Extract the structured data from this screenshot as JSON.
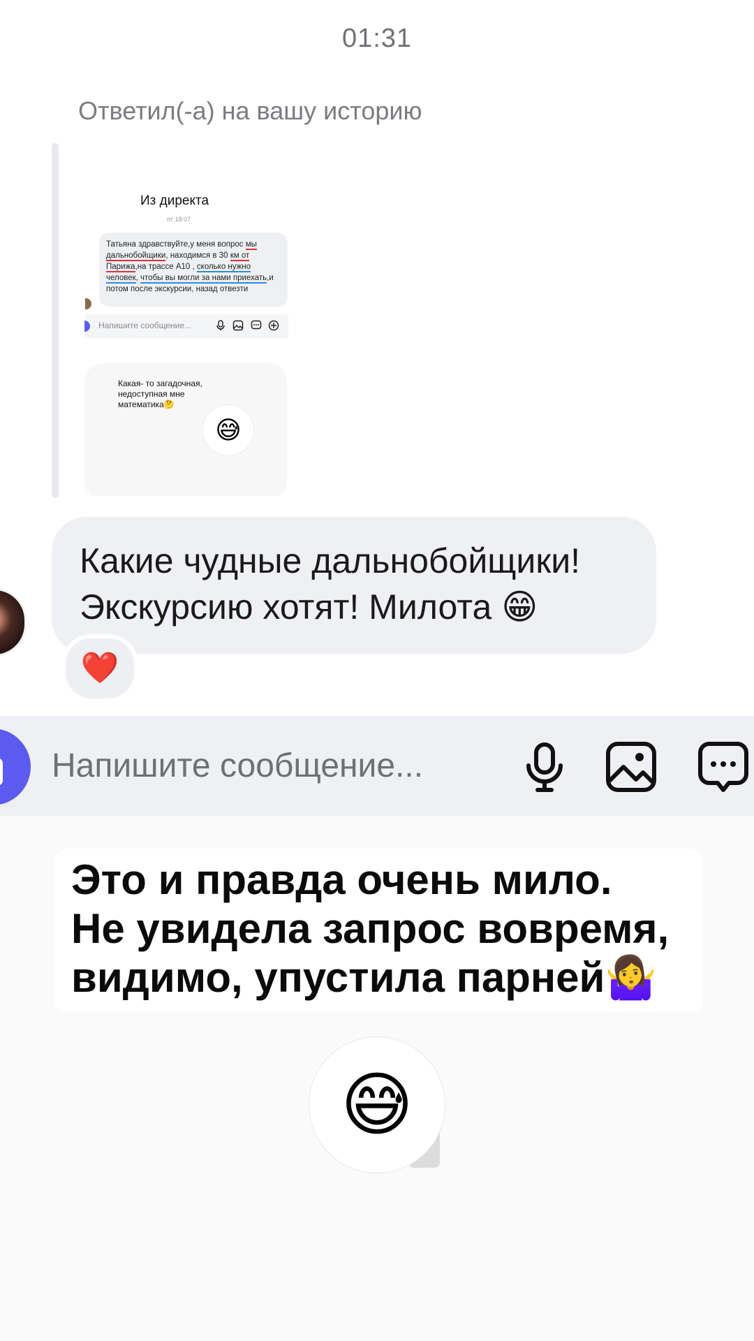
{
  "status": {
    "time": "01:31"
  },
  "reply": {
    "caption": "Ответил(-а) на вашу историю",
    "story": {
      "title": "Из директа",
      "date": "пт 18:07",
      "message": {
        "p1": "Татьяна здравствуйте,у меня вопрос ",
        "u1": "мы дальнобойщики",
        "p2": ", находимся в 30 ",
        "u2": "км от Парижа",
        "p3": ",на трассе А10 , ",
        "u3": "сколько нужно человек",
        "p4": ", ",
        "u4": "чтобы вы могли за нами приехать",
        "p5": ",и потом после экскурсии, назад отвезти"
      },
      "input_placeholder": "Напишите сообщение...",
      "card_text": "Какая- то загадочная, недоступная мне математика🤔",
      "card_emoji": "😅"
    }
  },
  "message": {
    "line1": "Какие чудные дальнобойщики!",
    "line2": "Экскурсию хотят! Милота 😁",
    "reaction": "❤️"
  },
  "input": {
    "placeholder": "Напишите сообщение..."
  },
  "icons": [
    "mic-icon",
    "image-icon",
    "sticker-icon",
    "camera-icon"
  ],
  "overlay": {
    "line1": "Это и правда очень мило.",
    "line2": "Не увидела запрос вовремя,",
    "line3": "видимо, упустила парней🤷‍♀️"
  },
  "sticker": {
    "emoji": "😅"
  },
  "colors": {
    "accent": "#5b5bf0",
    "bubble": "#eff0f3",
    "text": "#1a1a1a",
    "reaction": "#e0202a"
  }
}
